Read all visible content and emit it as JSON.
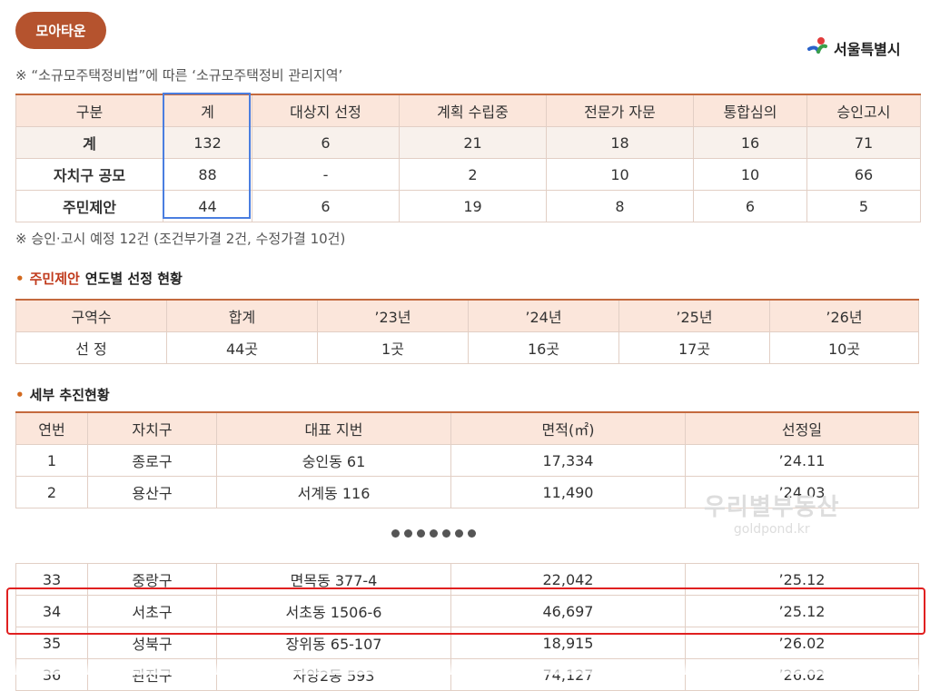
{
  "badge": "모아타운",
  "logo": {
    "text": "서울특별시",
    "icon": "seoul-symbol-icon"
  },
  "note1": "※ “소규모주택정비법”에 따른 ‘소규모주택정비 관리지역’",
  "summary": {
    "headers": [
      "구분",
      "계",
      "대상지 선정",
      "계획 수립중",
      "전문가 자문",
      "통합심의",
      "승인고시"
    ],
    "rows": [
      [
        "계",
        "132",
        "6",
        "21",
        "18",
        "16",
        "71"
      ],
      [
        "자치구 공모",
        "88",
        "-",
        "2",
        "10",
        "10",
        "66"
      ],
      [
        "주민제안",
        "44",
        "6",
        "19",
        "8",
        "6",
        "5"
      ]
    ]
  },
  "note2": "※ 승인·고시 예정 12건 (조건부가결 2건, 수정가결 10건)",
  "section2": {
    "highlight": "주민제안",
    "title": "연도별 선정 현황"
  },
  "yearly": {
    "headers": [
      "구역수",
      "합계",
      "’23년",
      "’24년",
      "’25년",
      "’26년"
    ],
    "row": [
      "선 정",
      "44곳",
      "1곳",
      "16곳",
      "17곳",
      "10곳"
    ]
  },
  "section3": {
    "title": "세부 추진현황"
  },
  "detail": {
    "headers": [
      "연번",
      "자치구",
      "대표 지번",
      "면적(㎡)",
      "선정일"
    ],
    "rows": [
      [
        "1",
        "종로구",
        "숭인동 61",
        "17,334",
        "’24.11"
      ],
      [
        "2",
        "용산구",
        "서계동 116",
        "11,490",
        "’24.03"
      ]
    ],
    "rows_after": [
      [
        "33",
        "중랑구",
        "면목동 377-4",
        "22,042",
        "’25.12"
      ],
      [
        "34",
        "서초구",
        "서초동 1506-6",
        "46,697",
        "’25.12"
      ],
      [
        "35",
        "성북구",
        "장위동 65-107",
        "18,915",
        "’26.02"
      ],
      [
        "36",
        "관진구",
        "자양2동 593",
        "74,127",
        "’26.02"
      ]
    ]
  },
  "watermark": {
    "title": "우리별부동산",
    "domain": "goldpond.kr"
  },
  "colors": {
    "accent": "#b5532e",
    "highlight_blue": "#4a7ee0",
    "highlight_red": "#e02020",
    "header_bg": "#fbe6db"
  }
}
